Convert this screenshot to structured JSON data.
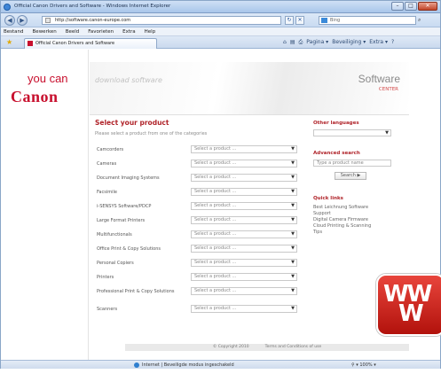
{
  "window": {
    "title": "Official Canon Drivers and Software - Windows Internet Explorer",
    "minimize": "–",
    "maximize": "□",
    "close": "✕"
  },
  "address_bar": {
    "back_icon": "◀",
    "forward_icon": "▶",
    "url": "http://software.canon-europe.com",
    "refresh_icon": "↻",
    "stop_icon": "✕",
    "search_placeholder": "Bing",
    "search_icon": "⌕"
  },
  "menu": [
    "Bestand",
    "Bewerken",
    "Beeld",
    "Favorieten",
    "Extra",
    "Help"
  ],
  "tab": {
    "label": "Official Canon Drivers and Software"
  },
  "command_bar": {
    "home": "⌂",
    "feeds": "▤",
    "print": "⎙",
    "page": "Pagina ▾",
    "safety": "Beveiliging ▾",
    "tools": "Extra ▾",
    "help": "?"
  },
  "brand": {
    "you_can": "you can",
    "canon": "Canon"
  },
  "banner": {
    "slogan": "download software",
    "title": "Software",
    "subtitle": "CENTER"
  },
  "main": {
    "heading": "Select your product",
    "subtext": "Please select a product from one of the categories",
    "rows": [
      {
        "label": "Camcorders",
        "select": "Select a product ..."
      },
      {
        "label": "Cameras",
        "select": "Select a product ..."
      },
      {
        "label": "Document Imaging Systems",
        "select": "Select a product ..."
      },
      {
        "label": "Facsimile",
        "select": "Select a product ..."
      },
      {
        "label": "i-SENSYS Software/PDCP",
        "select": "Select a product ..."
      },
      {
        "label": "Large Format Printers",
        "select": "Select a product ..."
      },
      {
        "label": "Multifunctionals",
        "select": "Select a product ..."
      },
      {
        "label": "Office Print & Copy Solutions",
        "select": "Select a product ..."
      },
      {
        "label": "Personal Copiers",
        "select": "Select a product ..."
      },
      {
        "label": "Printers",
        "select": "Select a product ..."
      },
      {
        "label": "Professional Print & Copy Solutions",
        "select": "Select a product ..."
      },
      {
        "label": "Scanners",
        "select": "Select a product ..."
      }
    ]
  },
  "sidebar": {
    "languages_heading": "Other languages",
    "advanced_heading": "Advanced search",
    "search_placeholder": "Type a product name",
    "search_button": "Search ▶",
    "quick_heading": "Quick links",
    "quick_links": [
      "Best Leichnung Software",
      "Support",
      "Digital Camera Firmware",
      "Cloud Printing & Scanning",
      "Tips"
    ]
  },
  "footer": {
    "copyright": "© Copyright 2010",
    "terms": "Terms and Conditions of use"
  },
  "status": {
    "zone": "Internet | Beveiligde modus ingeschakeld",
    "zoom": "⚲ ▾  100% ▾"
  },
  "badge": {
    "line1": "WW",
    "line2": "W"
  },
  "colors": {
    "canon_red": "#c8102e",
    "heading_red": "#b0242a",
    "badge_red": "#d2281e"
  }
}
